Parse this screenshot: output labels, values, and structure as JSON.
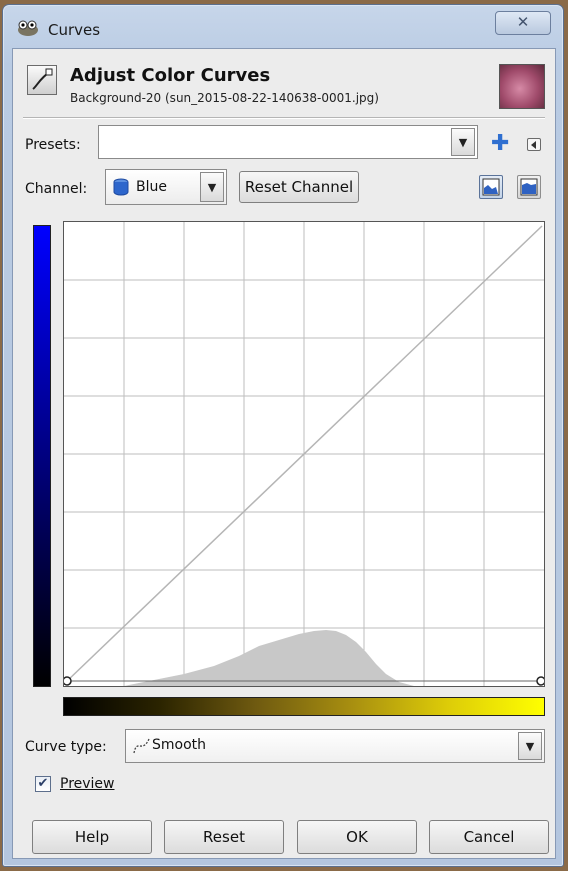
{
  "window": {
    "title": "Curves",
    "close_glyph": "✕"
  },
  "header": {
    "title": "Adjust Color Curves",
    "subtitle": "Background-20 (sun_2015-08-22-140638-0001.jpg)",
    "icon": "curves-tool-icon"
  },
  "presets": {
    "label": "Presets:",
    "value": "",
    "add_icon": "plus-icon",
    "menu_icon": "triangle-left-icon"
  },
  "channel": {
    "label": "Channel:",
    "value": "Blue",
    "reset_label": "Reset Channel",
    "view_buttons": [
      "linear-histogram-icon",
      "logarithmic-histogram-icon"
    ]
  },
  "colors": {
    "channel_bar": "#0000ff",
    "gradient_end": "#ffff00",
    "histogram": "#c8c8c8",
    "grid": "#bdbdbd"
  },
  "curve_type": {
    "label": "Curve type:",
    "value": "Smooth",
    "icon": "smooth-curve-icon"
  },
  "preview": {
    "label": "Preview",
    "checked": true
  },
  "buttons": {
    "help": "Help",
    "reset": "Reset",
    "ok": "OK",
    "cancel": "Cancel"
  }
}
